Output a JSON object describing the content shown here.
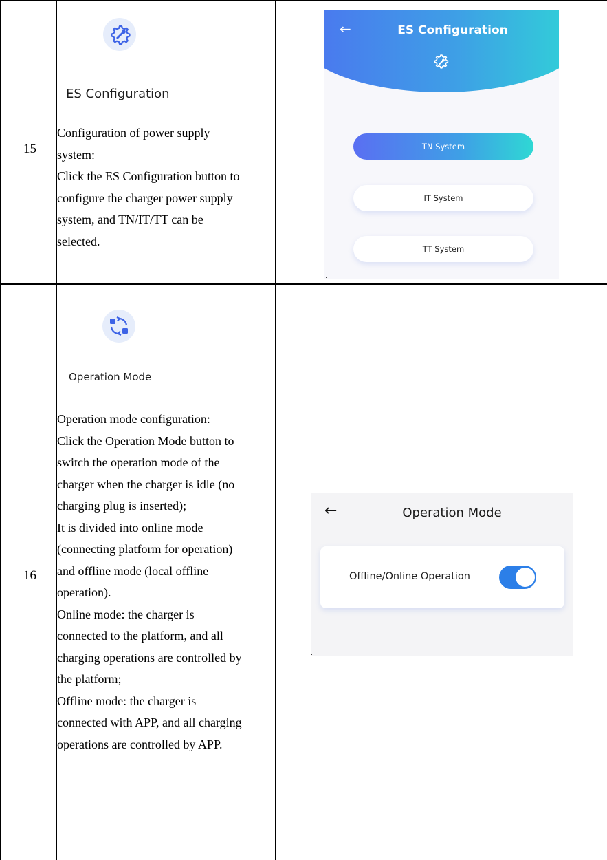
{
  "rows": [
    {
      "number": "15",
      "feature_title": "ES Configuration",
      "icon": "gear-wrench-icon",
      "description_lines": [
        "Configuration of power supply",
        "system:",
        "Click the ES Configuration button to",
        "configure the charger power supply",
        "system, and TN/IT/TT can be",
        "selected."
      ],
      "screen": {
        "title": "ES Configuration",
        "back_icon": "arrow-left-icon",
        "header_icon": "gear-wrench-icon",
        "options": [
          "TN System",
          "IT System",
          "TT System"
        ],
        "selected": "TN System",
        "colors": {
          "gradient_start": "#4c73f0",
          "gradient_end": "#2fd6d6"
        }
      }
    },
    {
      "number": "16",
      "feature_title": "Operation Mode",
      "icon": "switch-arrows-icon",
      "description_lines": [
        "Operation mode configuration:",
        "Click the Operation Mode button to",
        "switch the operation mode of the",
        "charger when the charger is idle (no",
        "charging plug is inserted);",
        "It is divided into online mode",
        "(connecting platform for operation)",
        "and offline mode (local offline",
        "operation).",
        "Online mode: the charger is",
        "connected to the platform, and all",
        "charging operations are controlled by",
        "the platform;",
        "Offline mode: the charger is",
        "connected with APP, and all charging",
        "operations are controlled by APP."
      ],
      "screen": {
        "title": "Operation Mode",
        "back_icon": "arrow-left-icon",
        "setting_label": "Offline/Online Operation",
        "toggle_on": true,
        "colors": {
          "toggle": "#2c7fe8"
        }
      }
    }
  ]
}
